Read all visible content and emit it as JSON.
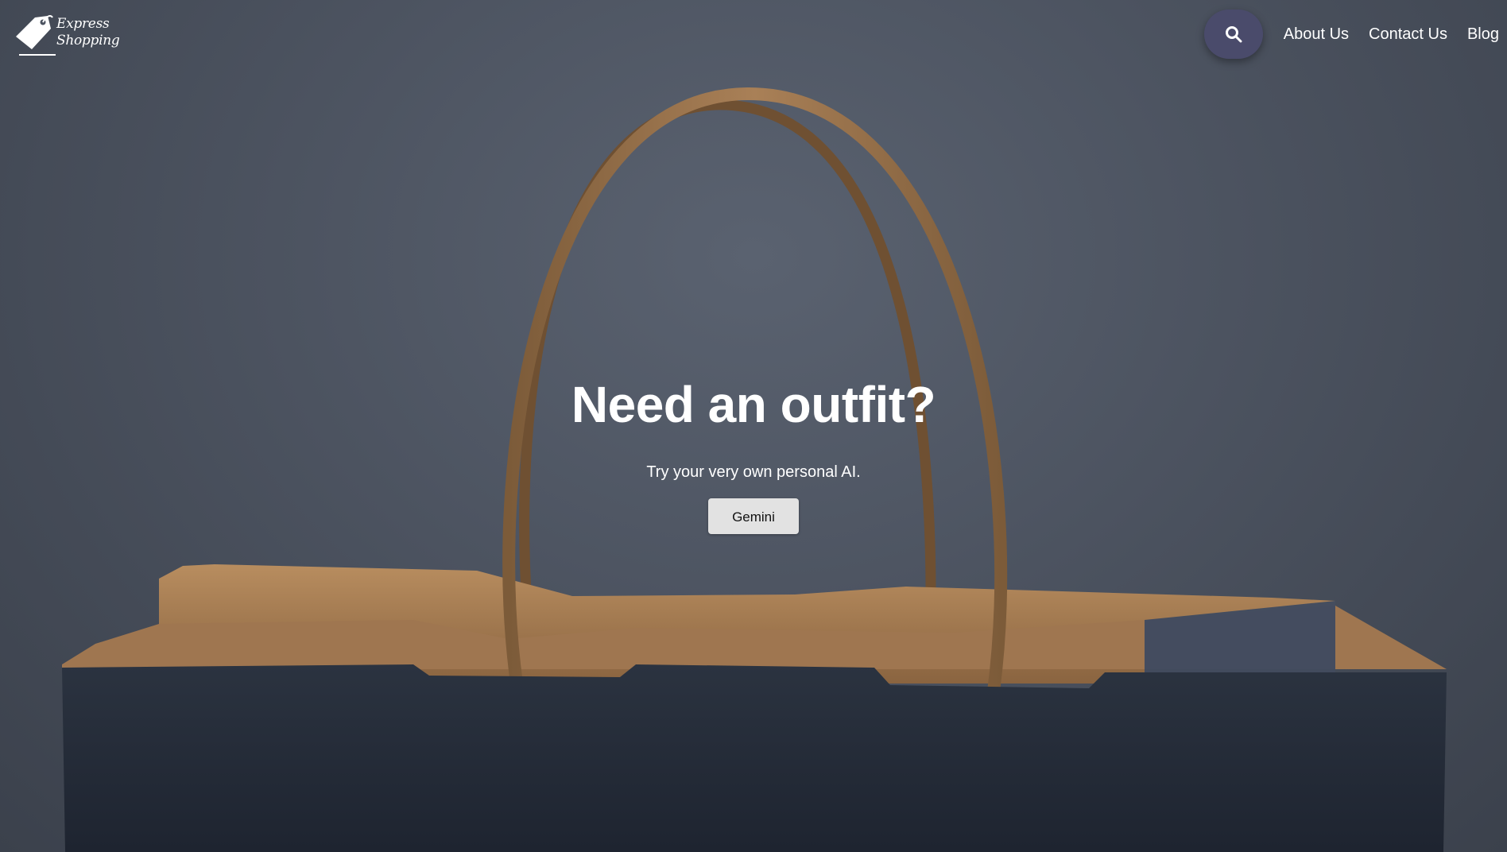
{
  "brand": {
    "line1": "Express",
    "line2": "Shopping",
    "logo_icon": "price-tag-icon"
  },
  "nav": {
    "search_icon": "search-icon",
    "links": [
      "About Us",
      "Contact Us",
      "Blog"
    ]
  },
  "hero": {
    "title": "Need an outfit?",
    "subtitle": "Try your very own personal AI.",
    "button_label": "Gemini"
  },
  "colors": {
    "background": "#4c5360",
    "search_button": "#4a4b6b",
    "bag_body": "#252c38",
    "bag_paper": "#a67c52",
    "cta_button": "#e2e2e2"
  }
}
